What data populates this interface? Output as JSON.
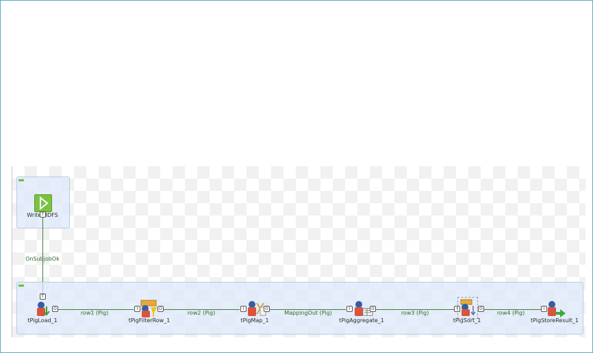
{
  "job": {
    "start_component": {
      "label": "Write HDFS",
      "trigger_port": "T"
    },
    "trigger_link": {
      "label": "OnSubjobOk"
    },
    "ports": {
      "input": "I",
      "output": "O"
    },
    "components": [
      {
        "label": "tPigLoad_1"
      },
      {
        "label": "tPigFilterRow_1"
      },
      {
        "label": "tPigMap_1"
      },
      {
        "label": "tPigAggregate_1"
      },
      {
        "label": "tPigSort_1"
      },
      {
        "label": "tPigStoreResult_1"
      }
    ],
    "links": [
      {
        "label": "row1 (Pig)"
      },
      {
        "label": "row2 (Pig)"
      },
      {
        "label": "MappingOut (Pig)"
      },
      {
        "label": "row3 (Pig)"
      },
      {
        "label": "row4 (Pig)"
      }
    ]
  },
  "colors": {
    "frame_border": "#5aa7c9",
    "subjob_fill": "#dce8f8",
    "connection": "#3d7d3d",
    "start_icon": "#7cc242"
  }
}
